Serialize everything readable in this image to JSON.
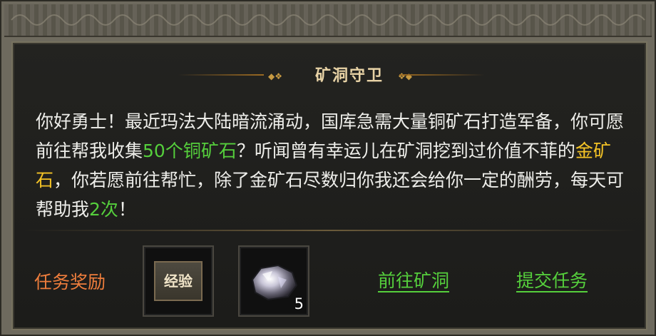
{
  "dialog": {
    "title": "矿洞守卫",
    "description": {
      "part1": "你好勇士！最近玛法大陆暗流涌动，国库急需大量铜矿石打造军备，你可愿前往帮我收集",
      "highlight1": "50个铜矿石",
      "part2": "？听闻曾有幸运儿在矿洞挖到过价值不菲的",
      "highlight2": "金矿石",
      "part3": "，你若愿前往帮忙，除了金矿石尽数归你我还会给你一定的酬劳，每天可帮助我",
      "highlight3": "2次",
      "part4": "！"
    },
    "colors": {
      "highlight_green": "#55cf3c",
      "highlight_gold": "#f4c326",
      "reward_label": "#ee7d3c"
    }
  },
  "rewards": {
    "label": "任务奖励",
    "items": [
      {
        "icon": "experience-icon",
        "text": "经验"
      },
      {
        "icon": "ore-icon",
        "count": "5"
      }
    ]
  },
  "actions": {
    "go_to_mine": "前往矿洞",
    "submit_task": "提交任务"
  }
}
